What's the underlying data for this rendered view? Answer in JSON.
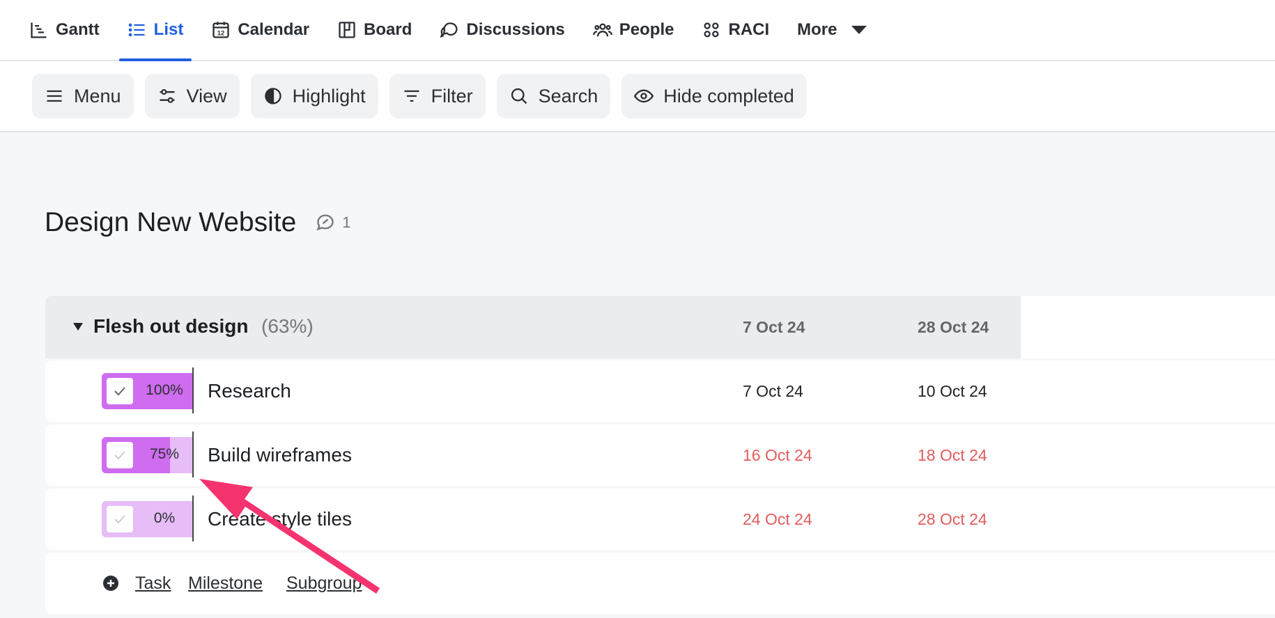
{
  "nav": {
    "tabs": [
      {
        "label": "Gantt",
        "icon": "gantt-icon",
        "active": false
      },
      {
        "label": "List",
        "icon": "list-icon",
        "active": true
      },
      {
        "label": "Calendar",
        "icon": "calendar-icon",
        "active": false
      },
      {
        "label": "Board",
        "icon": "board-icon",
        "active": false
      },
      {
        "label": "Discussions",
        "icon": "discussions-icon",
        "active": false
      },
      {
        "label": "People",
        "icon": "people-icon",
        "active": false
      },
      {
        "label": "RACI",
        "icon": "raci-icon",
        "active": false
      },
      {
        "label": "More",
        "icon": "chevron-down-icon",
        "active": false
      }
    ],
    "calendar_icon_day": "12",
    "active_color": "#1f5fe0"
  },
  "toolbar": {
    "menu_label": "Menu",
    "view_label": "View",
    "highlight_label": "Highlight",
    "filter_label": "Filter",
    "search_label": "Search",
    "hide_completed_label": "Hide completed"
  },
  "project": {
    "title": "Design New Website",
    "comment_count": "1"
  },
  "group": {
    "name": "Flesh out design",
    "percent": "(63%)",
    "start": "7 Oct 24",
    "end": "28 Oct 24"
  },
  "tasks": [
    {
      "name": "Research",
      "progress_label": "100%",
      "progress": 1.0,
      "start": "7 Oct 24",
      "end": "10 Oct 24",
      "overdue": false
    },
    {
      "name": "Build wireframes",
      "progress_label": "75%",
      "progress": 0.75,
      "start": "16 Oct 24",
      "end": "18 Oct 24",
      "overdue": true
    },
    {
      "name": "Create style tiles",
      "progress_label": "0%",
      "progress": 0.0,
      "start": "24 Oct 24",
      "end": "28 Oct 24",
      "overdue": true
    }
  ],
  "add": {
    "task_label": "Task",
    "milestone_label": "Milestone",
    "subgroup_label": "Subgroup"
  },
  "colors": {
    "progress_fill": "#cf6cf0",
    "progress_track": "#e6bdf6",
    "overdue": "#e25c5c",
    "annotation_arrow": "#f5336f"
  }
}
